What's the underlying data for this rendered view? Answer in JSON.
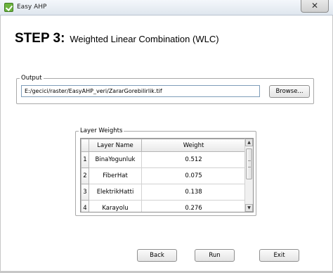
{
  "window": {
    "title": "Easy AHP",
    "close_symbol": "✕",
    "icon": "easy-ahp-check-icon"
  },
  "heading": {
    "step": "STEP 3:",
    "title": "Weighted Linear Combination (WLC)"
  },
  "output": {
    "group_label": "Output",
    "path_value": "E:/gecici/raster/EasyAHP_veri/ZararGorebilirlik.tif",
    "browse_label": "Browse..."
  },
  "layer_weights": {
    "group_label": "Layer Weights",
    "columns": [
      "Layer Name",
      "Weight"
    ],
    "rows": [
      {
        "num": "1",
        "name": "BinaYogunluk",
        "weight": "0.512"
      },
      {
        "num": "2",
        "name": "FiberHat",
        "weight": "0.075"
      },
      {
        "num": "3",
        "name": "ElektrikHatti",
        "weight": "0.138"
      },
      {
        "num": "4",
        "name": "Karayolu",
        "weight": "0.276"
      }
    ],
    "scroll_up": "▲",
    "scroll_down": "▼"
  },
  "footer": {
    "back_label": "Back",
    "run_label": "Run",
    "exit_label": "Exit"
  }
}
